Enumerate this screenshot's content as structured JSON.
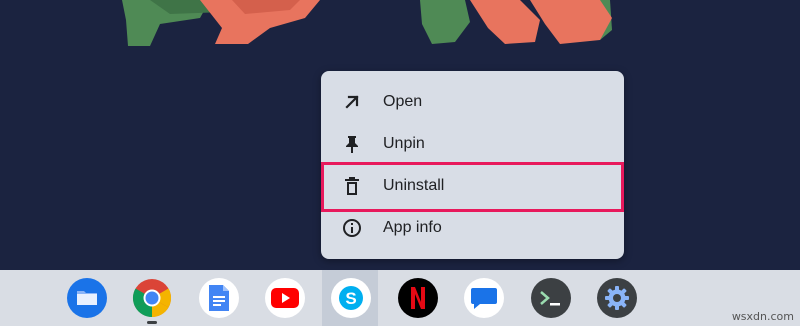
{
  "context_menu": {
    "items": [
      {
        "label": "Open",
        "icon": "arrow-up-right-icon"
      },
      {
        "label": "Unpin",
        "icon": "pin-icon"
      },
      {
        "label": "Uninstall",
        "icon": "trash-icon",
        "highlighted": true
      },
      {
        "label": "App info",
        "icon": "info-icon"
      }
    ],
    "highlight_color": "#e8195c"
  },
  "shelf": {
    "apps": [
      {
        "name": "Files",
        "icon": "files-icon"
      },
      {
        "name": "Chrome",
        "icon": "chrome-icon",
        "running": true
      },
      {
        "name": "Docs",
        "icon": "docs-icon"
      },
      {
        "name": "YouTube",
        "icon": "youtube-icon"
      },
      {
        "name": "Skype",
        "icon": "skype-icon",
        "active": true
      },
      {
        "name": "Netflix",
        "icon": "netflix-icon"
      },
      {
        "name": "Messages",
        "icon": "messages-icon"
      },
      {
        "name": "Terminal",
        "icon": "terminal-icon"
      },
      {
        "name": "Settings",
        "icon": "settings-icon"
      }
    ]
  },
  "colors": {
    "wallpaper_bg": "#1b2340",
    "wallpaper_green": "#4f8a55",
    "wallpaper_orange": "#e8745e",
    "menu_bg": "#d8dde6",
    "shelf_bg": "#d9dde4"
  },
  "watermark": "wsxdn.com"
}
